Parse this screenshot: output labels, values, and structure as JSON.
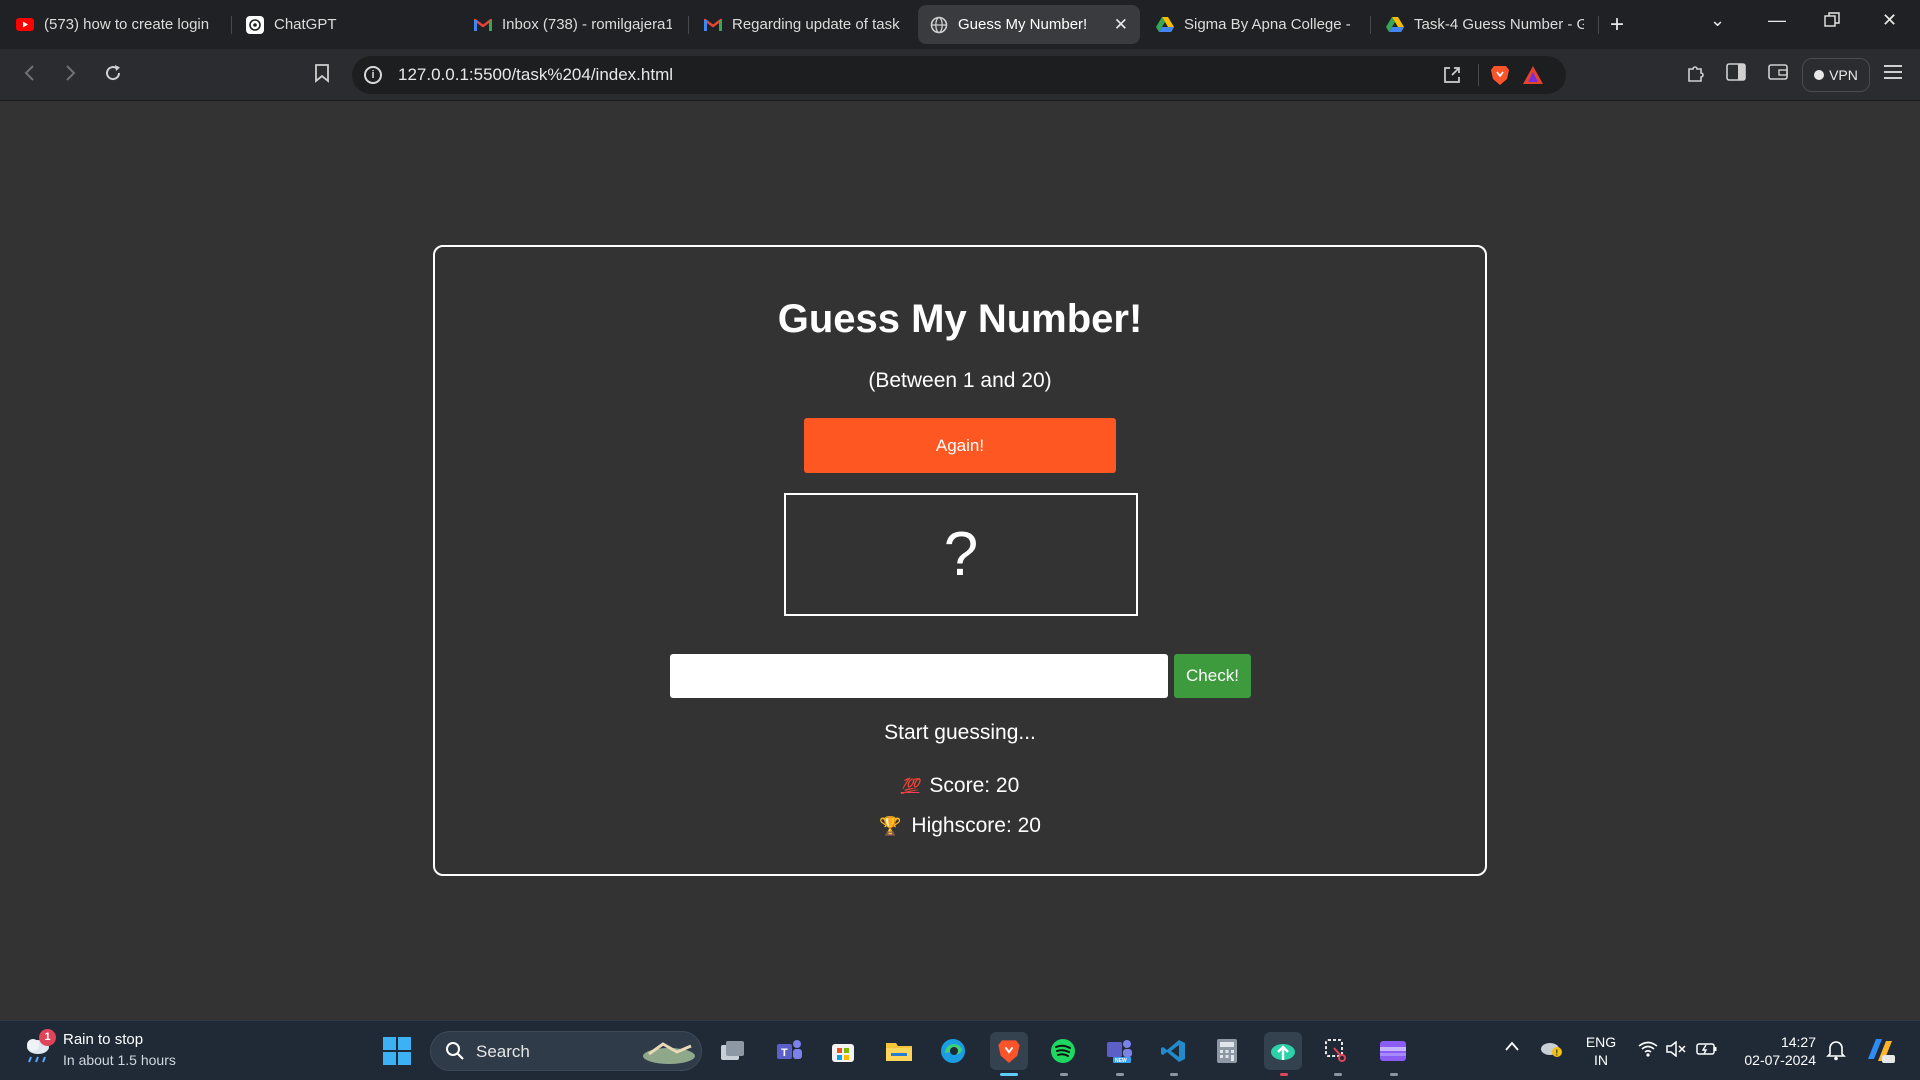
{
  "browser": {
    "tabs": [
      {
        "title": "(573) how to create login",
        "icon": "youtube-icon"
      },
      {
        "title": "ChatGPT",
        "icon": "chatgpt-icon"
      },
      {
        "title": "Inbox (738) - romilgajera1",
        "icon": "gmail-icon"
      },
      {
        "title": "Regarding update of task",
        "icon": "gmail-icon"
      },
      {
        "title": "Guess My Number!",
        "icon": "globe-icon",
        "active": true
      },
      {
        "title": "Sigma By Apna College - (",
        "icon": "google-drive-icon"
      },
      {
        "title": "Task-4 Guess Number - G",
        "icon": "google-drive-icon"
      }
    ],
    "url": "127.0.0.1:5500/task%204/index.html",
    "vpn_label": "VPN"
  },
  "game": {
    "title": "Guess My Number!",
    "range": "(Between 1 and 20)",
    "again_label": "Again!",
    "secret_display": "?",
    "guess_value": "",
    "check_label": "Check!",
    "message": "Start guessing...",
    "score_label": "Score: 20",
    "highscore_label": "Highscore: 20",
    "score_emoji": "💯",
    "highscore_emoji": "🏆"
  },
  "taskbar": {
    "weather_title": "Rain to stop",
    "weather_subtitle": "In about 1.5 hours",
    "weather_badge": "1",
    "search_label": "Search",
    "lang_top": "ENG",
    "lang_bottom": "IN",
    "time": "14:27",
    "date": "02-07-2024"
  },
  "colors": {
    "page_bg": "#333333",
    "again_button": "#ff5722",
    "check_button": "#3d9a3d",
    "card_border": "#ffffff"
  }
}
